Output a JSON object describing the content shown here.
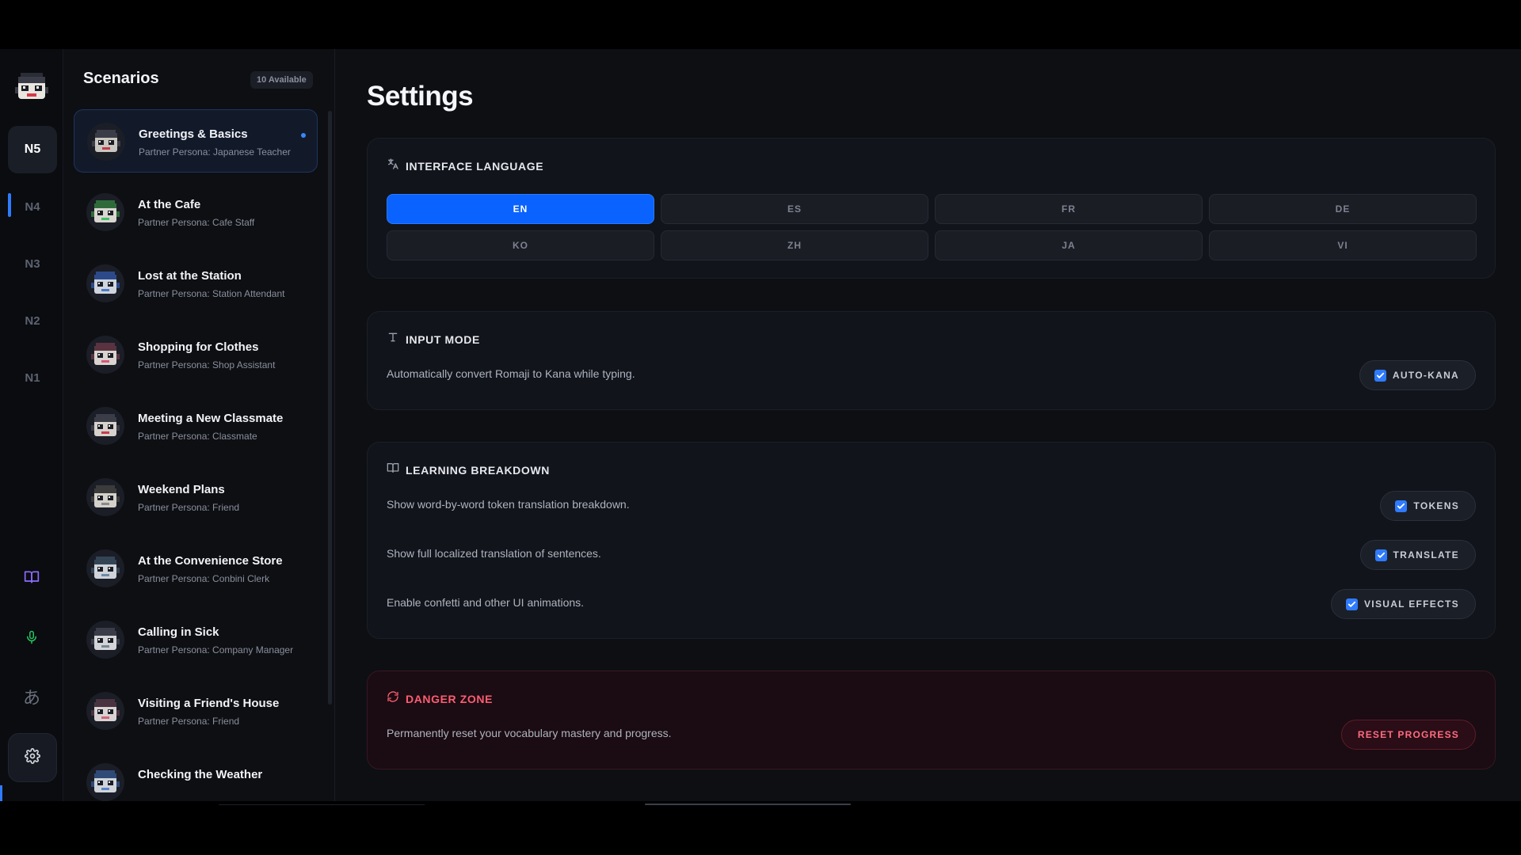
{
  "rail": {
    "levels": [
      "N5",
      "N4",
      "N3",
      "N2",
      "N1"
    ],
    "active_level": "N5",
    "icons": [
      "book-icon",
      "microphone-icon",
      "hiragana-icon",
      "gear-icon"
    ],
    "hiragana_glyph": "あ"
  },
  "scenarios": {
    "title": "Scenarios",
    "badge": "10 Available",
    "items": [
      {
        "title": "Greetings & Basics",
        "subtitle": "Partner Persona: Japanese Teacher",
        "active": true
      },
      {
        "title": "At the Cafe",
        "subtitle": "Partner Persona: Cafe Staff"
      },
      {
        "title": "Lost at the Station",
        "subtitle": "Partner Persona: Station Attendant"
      },
      {
        "title": "Shopping for Clothes",
        "subtitle": "Partner Persona: Shop Assistant"
      },
      {
        "title": "Meeting a New Classmate",
        "subtitle": "Partner Persona: Classmate"
      },
      {
        "title": "Weekend Plans",
        "subtitle": "Partner Persona: Friend"
      },
      {
        "title": "At the Convenience Store",
        "subtitle": "Partner Persona: Conbini Clerk"
      },
      {
        "title": "Calling in Sick",
        "subtitle": "Partner Persona: Company Manager"
      },
      {
        "title": "Visiting a Friend's House",
        "subtitle": "Partner Persona: Friend"
      },
      {
        "title": "Checking the Weather",
        "subtitle": ""
      }
    ]
  },
  "settings": {
    "title": "Settings",
    "interface_language": {
      "heading": "INTERFACE LANGUAGE",
      "options": [
        "EN",
        "ES",
        "FR",
        "DE",
        "KO",
        "ZH",
        "JA",
        "VI"
      ],
      "selected": "EN"
    },
    "input_mode": {
      "heading": "INPUT MODE",
      "description": "Automatically convert Romaji to Kana while typing.",
      "toggle_label": "AUTO-KANA",
      "checked": true
    },
    "learning_breakdown": {
      "heading": "LEARNING BREAKDOWN",
      "rows": [
        {
          "description": "Show word-by-word token translation breakdown.",
          "toggle_label": "TOKENS",
          "checked": true
        },
        {
          "description": "Show full localized translation of sentences.",
          "toggle_label": "TRANSLATE",
          "checked": true
        },
        {
          "description": "Enable confetti and other UI animations.",
          "toggle_label": "VISUAL EFFECTS",
          "checked": true
        }
      ]
    },
    "danger_zone": {
      "heading": "DANGER ZONE",
      "description": "Permanently reset your vocabulary mastery and progress.",
      "button_label": "RESET PROGRESS"
    }
  },
  "colors": {
    "accent": "#0a62ff",
    "danger": "#ff5c73",
    "background": "#0d0f13"
  }
}
